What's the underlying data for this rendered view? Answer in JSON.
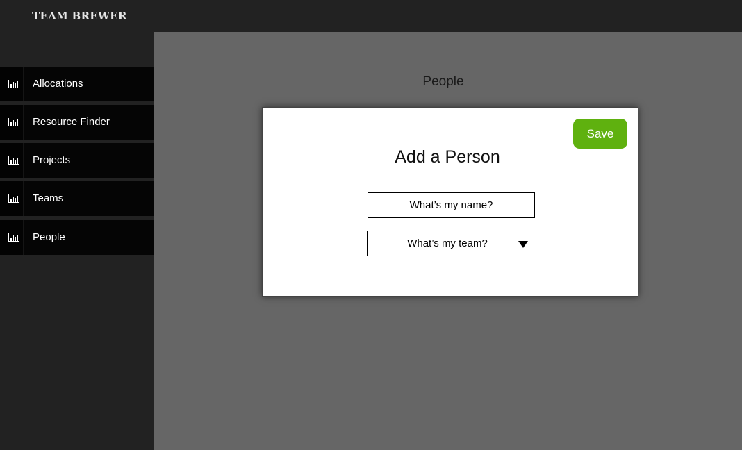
{
  "app": {
    "brand": "TEAM BREWER"
  },
  "sidebar": {
    "items": [
      {
        "label": "Allocations",
        "icon": "bar-chart-icon"
      },
      {
        "label": "Resource Finder",
        "icon": "bar-chart-icon"
      },
      {
        "label": "Projects",
        "icon": "bar-chart-icon"
      },
      {
        "label": "Teams",
        "icon": "bar-chart-icon"
      },
      {
        "label": "People",
        "icon": "bar-chart-icon"
      }
    ]
  },
  "main": {
    "title": "People"
  },
  "modal": {
    "title": "Add a Person",
    "save_label": "Save",
    "name_placeholder": "What’s my name?",
    "team_placeholder": "What’s my team?"
  },
  "colors": {
    "accent": "#5fb10f",
    "sidebar_bg": "#222222",
    "nav_item_bg": "#050505",
    "main_bg": "#666666"
  }
}
